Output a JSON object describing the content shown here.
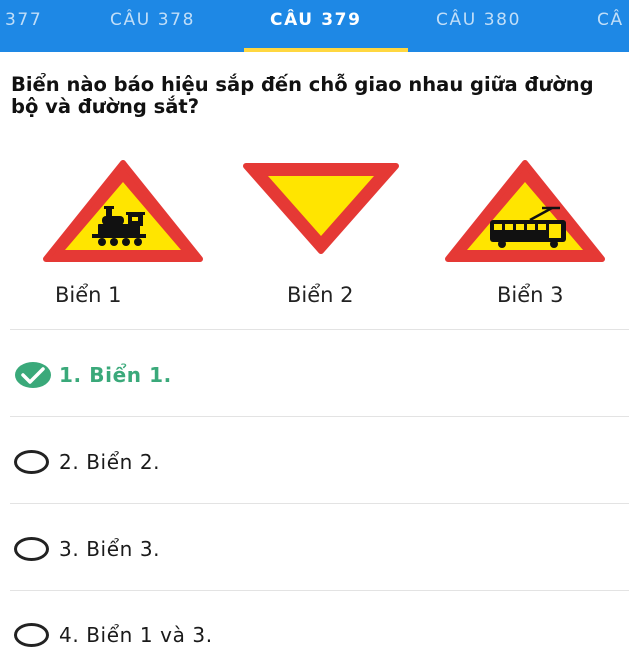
{
  "tabs": [
    {
      "label": "377"
    },
    {
      "label": "CÂU 378"
    },
    {
      "label": "CÂU 379",
      "active": true
    },
    {
      "label": "CÂU 380"
    },
    {
      "label": "CÂ"
    }
  ],
  "question": "Biển nào báo hiệu sắp đến chỗ giao nhau giữa đường bộ và đường sắt?",
  "signs": [
    {
      "label": "Biển 1",
      "icon": "train-warning-sign-icon"
    },
    {
      "label": "Biển 2",
      "icon": "give-way-sign-icon"
    },
    {
      "label": "Biển 3",
      "icon": "tram-warning-sign-icon"
    }
  ],
  "answers": [
    {
      "text": "1. Biển 1.",
      "correct": true
    },
    {
      "text": "2. Biển 2.",
      "correct": false
    },
    {
      "text": "3. Biển 3.",
      "correct": false
    },
    {
      "text": "4. Biển 1 và 3.",
      "correct": false
    }
  ],
  "colors": {
    "tabbar": "#1e88e5",
    "indicator": "#ffd740",
    "correct": "#3aa97a",
    "sign_border": "#e53935",
    "sign_fill": "#ffe500"
  }
}
